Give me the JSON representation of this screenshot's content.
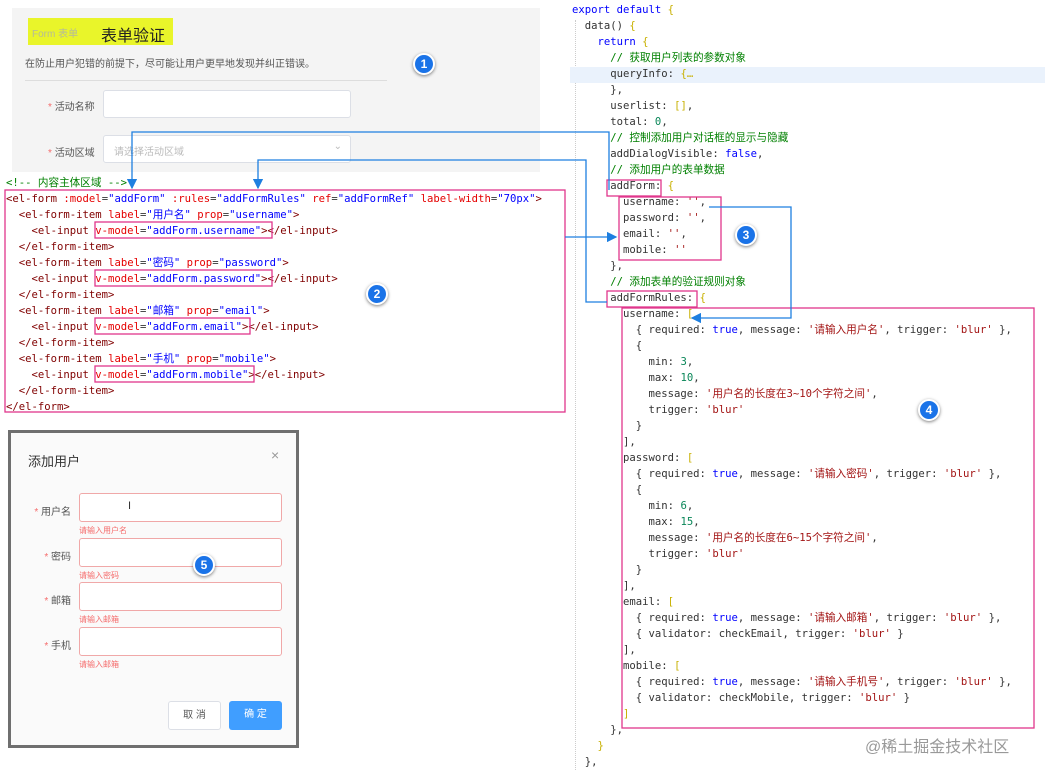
{
  "demo": {
    "crumb_small": "Form 表单",
    "title": "表单验证",
    "description": "在防止用户犯错的前提下，尽可能让用户更早地发现并纠正错误。",
    "fields": [
      {
        "label": "活动名称",
        "required": "*",
        "value": "",
        "placeholder": ""
      },
      {
        "label": "活动区域",
        "required": "*",
        "placeholder": "请选择活动区域"
      }
    ]
  },
  "badges": [
    "1",
    "2",
    "3",
    "4",
    "5"
  ],
  "left_code": [
    [
      [
        "<!-- ",
        "c"
      ],
      [
        "内容主体区域 -->",
        "c"
      ]
    ],
    [
      [
        "<el-form ",
        "tg"
      ],
      [
        ":model",
        "at"
      ],
      [
        "=",
        "p"
      ],
      [
        "\"addForm\"",
        "v"
      ],
      [
        " :rules",
        "at"
      ],
      [
        "=",
        "p"
      ],
      [
        "\"addFormRules\"",
        "v"
      ],
      [
        " ref",
        "at"
      ],
      [
        "=",
        "p"
      ],
      [
        "\"addFormRef\"",
        "v"
      ],
      [
        " label-width",
        "at"
      ],
      [
        "=",
        "p"
      ],
      [
        "\"70px\"",
        "v"
      ],
      [
        ">",
        "tg"
      ]
    ],
    [
      [
        "  <el-form-item ",
        "tg"
      ],
      [
        "label",
        "at"
      ],
      [
        "=",
        "p"
      ],
      [
        "\"用户名\"",
        "v"
      ],
      [
        " prop",
        "at"
      ],
      [
        "=",
        "p"
      ],
      [
        "\"username\"",
        "v"
      ],
      [
        ">",
        "tg"
      ]
    ],
    [
      [
        "    <el-input ",
        "tg"
      ],
      [
        "v-model",
        "at"
      ],
      [
        "=",
        "p"
      ],
      [
        "\"addForm.username\"",
        "v"
      ],
      [
        "></el-input>",
        "tg"
      ]
    ],
    [
      [
        "  </el-form-item>",
        "tg"
      ]
    ],
    [
      [
        "  <el-form-item ",
        "tg"
      ],
      [
        "label",
        "at"
      ],
      [
        "=",
        "p"
      ],
      [
        "\"密码\"",
        "v"
      ],
      [
        " prop",
        "at"
      ],
      [
        "=",
        "p"
      ],
      [
        "\"password\"",
        "v"
      ],
      [
        ">",
        "tg"
      ]
    ],
    [
      [
        "    <el-input ",
        "tg"
      ],
      [
        "v-model",
        "at"
      ],
      [
        "=",
        "p"
      ],
      [
        "\"addForm.password\"",
        "v"
      ],
      [
        "></el-input>",
        "tg"
      ]
    ],
    [
      [
        "  </el-form-item>",
        "tg"
      ]
    ],
    [
      [
        "  <el-form-item ",
        "tg"
      ],
      [
        "label",
        "at"
      ],
      [
        "=",
        "p"
      ],
      [
        "\"邮箱\"",
        "v"
      ],
      [
        " prop",
        "at"
      ],
      [
        "=",
        "p"
      ],
      [
        "\"email\"",
        "v"
      ],
      [
        ">",
        "tg"
      ]
    ],
    [
      [
        "    <el-input ",
        "tg"
      ],
      [
        "v-model",
        "at"
      ],
      [
        "=",
        "p"
      ],
      [
        "\"addForm.email\"",
        "v"
      ],
      [
        "></el-input>",
        "tg"
      ]
    ],
    [
      [
        "  </el-form-item>",
        "tg"
      ]
    ],
    [
      [
        "  <el-form-item ",
        "tg"
      ],
      [
        "label",
        "at"
      ],
      [
        "=",
        "p"
      ],
      [
        "\"手机\"",
        "v"
      ],
      [
        " prop",
        "at"
      ],
      [
        "=",
        "p"
      ],
      [
        "\"mobile\"",
        "v"
      ],
      [
        ">",
        "tg"
      ]
    ],
    [
      [
        "    <el-input ",
        "tg"
      ],
      [
        "v-model",
        "at"
      ],
      [
        "=",
        "p"
      ],
      [
        "\"addForm.mobile\"",
        "v"
      ],
      [
        "></el-input>",
        "tg"
      ]
    ],
    [
      [
        "  </el-form-item>",
        "tg"
      ]
    ],
    [
      [
        "</el-form>",
        "tg"
      ]
    ]
  ],
  "right_code": [
    [
      [
        "export default ",
        "k"
      ],
      [
        "{",
        "b"
      ]
    ],
    [
      [
        "  data() ",
        "p"
      ],
      [
        "{",
        "b"
      ]
    ],
    [
      [
        "    return ",
        "k"
      ],
      [
        "{",
        "b"
      ]
    ],
    [
      [
        "      // 获取用户列表的参数对象",
        "c"
      ]
    ],
    [
      [
        "      queryInfo: ",
        "p"
      ],
      [
        "{…",
        "b"
      ]
    ],
    [
      [
        "      },",
        "p"
      ]
    ],
    [
      [
        "      userlist: ",
        "p"
      ],
      [
        "[]",
        "b"
      ],
      [
        ",",
        "p"
      ]
    ],
    [
      [
        "      total: ",
        "p"
      ],
      [
        "0",
        "n"
      ],
      [
        ",",
        "p"
      ]
    ],
    [
      [
        "      // 控制添加用户对话框的显示与隐藏",
        "c"
      ]
    ],
    [
      [
        "      addDialogVisible: ",
        "p"
      ],
      [
        "false",
        "k"
      ],
      [
        ",",
        "p"
      ]
    ],
    [
      [
        "      // 添加用户的表单数据",
        "c"
      ]
    ],
    [
      [
        "      addForm: ",
        "p"
      ],
      [
        "{",
        "b"
      ]
    ],
    [
      [
        "        username: ",
        "p"
      ],
      [
        "''",
        "s"
      ],
      [
        ",",
        "p"
      ]
    ],
    [
      [
        "        password: ",
        "p"
      ],
      [
        "''",
        "s"
      ],
      [
        ",",
        "p"
      ]
    ],
    [
      [
        "        email: ",
        "p"
      ],
      [
        "''",
        "s"
      ],
      [
        ",",
        "p"
      ]
    ],
    [
      [
        "        mobile: ",
        "p"
      ],
      [
        "''",
        "s"
      ]
    ],
    [
      [
        "      },",
        "p"
      ]
    ],
    [
      [
        "      // 添加表单的验证规则对象",
        "c"
      ]
    ],
    [
      [
        "      addFormRules: ",
        "p"
      ],
      [
        "{",
        "b"
      ]
    ],
    [
      [
        "        username: ",
        "p"
      ],
      [
        "[",
        "b"
      ]
    ],
    [
      [
        "          { required: ",
        "p"
      ],
      [
        "true",
        "k"
      ],
      [
        ", message: ",
        "p"
      ],
      [
        "'请输入用户名'",
        "s"
      ],
      [
        ", trigger: ",
        "p"
      ],
      [
        "'blur'",
        "s"
      ],
      [
        " },",
        "p"
      ]
    ],
    [
      [
        "          {",
        "p"
      ]
    ],
    [
      [
        "            min: ",
        "p"
      ],
      [
        "3",
        "n"
      ],
      [
        ",",
        "p"
      ]
    ],
    [
      [
        "            max: ",
        "p"
      ],
      [
        "10",
        "n"
      ],
      [
        ",",
        "p"
      ]
    ],
    [
      [
        "            message: ",
        "p"
      ],
      [
        "'用户名的长度在3~10个字符之间'",
        "s"
      ],
      [
        ",",
        "p"
      ]
    ],
    [
      [
        "            trigger: ",
        "p"
      ],
      [
        "'blur'",
        "s"
      ]
    ],
    [
      [
        "          }",
        "p"
      ]
    ],
    [
      [
        "        ],",
        "p"
      ]
    ],
    [
      [
        "        password: ",
        "p"
      ],
      [
        "[",
        "b"
      ]
    ],
    [
      [
        "          { required: ",
        "p"
      ],
      [
        "true",
        "k"
      ],
      [
        ", message: ",
        "p"
      ],
      [
        "'请输入密码'",
        "s"
      ],
      [
        ", trigger: ",
        "p"
      ],
      [
        "'blur'",
        "s"
      ],
      [
        " },",
        "p"
      ]
    ],
    [
      [
        "          {",
        "p"
      ]
    ],
    [
      [
        "            min: ",
        "p"
      ],
      [
        "6",
        "n"
      ],
      [
        ",",
        "p"
      ]
    ],
    [
      [
        "            max: ",
        "p"
      ],
      [
        "15",
        "n"
      ],
      [
        ",",
        "p"
      ]
    ],
    [
      [
        "            message: ",
        "p"
      ],
      [
        "'用户名的长度在6~15个字符之间'",
        "s"
      ],
      [
        ",",
        "p"
      ]
    ],
    [
      [
        "            trigger: ",
        "p"
      ],
      [
        "'blur'",
        "s"
      ]
    ],
    [
      [
        "          }",
        "p"
      ]
    ],
    [
      [
        "        ],",
        "p"
      ]
    ],
    [
      [
        "        email: ",
        "p"
      ],
      [
        "[",
        "b"
      ]
    ],
    [
      [
        "          { required: ",
        "p"
      ],
      [
        "true",
        "k"
      ],
      [
        ", message: ",
        "p"
      ],
      [
        "'请输入邮箱'",
        "s"
      ],
      [
        ", trigger: ",
        "p"
      ],
      [
        "'blur'",
        "s"
      ],
      [
        " },",
        "p"
      ]
    ],
    [
      [
        "          { validator: checkEmail, trigger: ",
        "p"
      ],
      [
        "'blur'",
        "s"
      ],
      [
        " }",
        "p"
      ]
    ],
    [
      [
        "        ],",
        "p"
      ]
    ],
    [
      [
        "        mobile: ",
        "p"
      ],
      [
        "[",
        "b"
      ]
    ],
    [
      [
        "          { required: ",
        "p"
      ],
      [
        "true",
        "k"
      ],
      [
        ", message: ",
        "p"
      ],
      [
        "'请输入手机号'",
        "s"
      ],
      [
        ", trigger: ",
        "p"
      ],
      [
        "'blur'",
        "s"
      ],
      [
        " },",
        "p"
      ]
    ],
    [
      [
        "          { validator: checkMobile, trigger: ",
        "p"
      ],
      [
        "'blur'",
        "s"
      ],
      [
        " }",
        "p"
      ]
    ],
    [
      [
        "        ]",
        "b"
      ]
    ],
    [
      [
        "      },",
        "p"
      ]
    ],
    [
      [
        "    }",
        "b"
      ]
    ],
    [
      [
        "  },",
        "p"
      ]
    ]
  ],
  "dialog": {
    "title": "添加用户",
    "close": "×",
    "cursor": "I",
    "fields": [
      {
        "label": "用户名",
        "required": "*",
        "error": "请输入用户名"
      },
      {
        "label": "密码",
        "required": "*",
        "error": "请输入密码"
      },
      {
        "label": "邮箱",
        "required": "*",
        "error": "请输入邮箱"
      },
      {
        "label": "手机",
        "required": "*",
        "error": "请输入邮箱"
      }
    ],
    "cancel": "取 消",
    "confirm": "确 定"
  },
  "watermark": "@稀土掘金技术社区",
  "colors": {
    "highlight": "#e9f52a",
    "box": "#e0368c",
    "arrow": "#1e7fe0",
    "primary": "#409eff",
    "error": "#f56c6c"
  }
}
